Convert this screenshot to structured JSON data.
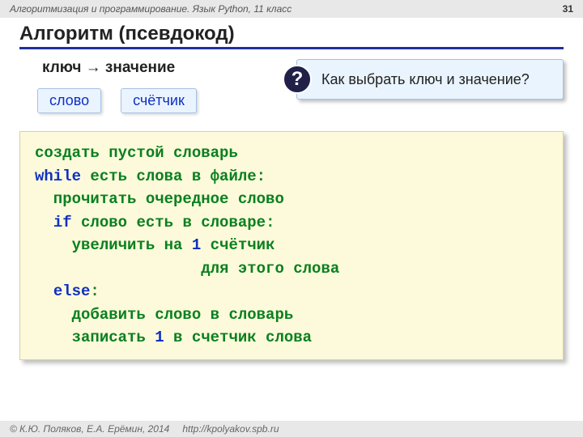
{
  "header": {
    "course": "Алгоритмизация и программирование. Язык Python, 11 класс",
    "page": "31"
  },
  "title": "Алгоритм (псевдокод)",
  "kv": "ключ → значение",
  "tags": {
    "key": "слово",
    "value": "счётчик"
  },
  "question": {
    "mark": "?",
    "text": "Как выбрать ключ и значение?"
  },
  "code": {
    "l1": "создать пустой словарь",
    "l2a": "while",
    "l2b": " есть слова в файле:",
    "l3": "  прочитать очередное слово",
    "l4a": "  ",
    "l4b": "if",
    "l4c": " слово есть в словаре:",
    "l5a": "    увеличить на ",
    "l5b": "1",
    "l5c": " счётчик",
    "l6": "                  для этого слова",
    "l7a": "  ",
    "l7b": "else",
    "l7c": ":",
    "l8": "    добавить слово в словарь",
    "l9a": "    записать ",
    "l9b": "1",
    "l9c": " в счетчик слова"
  },
  "footer": {
    "copyright": "© К.Ю. Поляков, Е.А. Ерёмин, 2014",
    "url": "http://kpolyakov.spb.ru"
  }
}
